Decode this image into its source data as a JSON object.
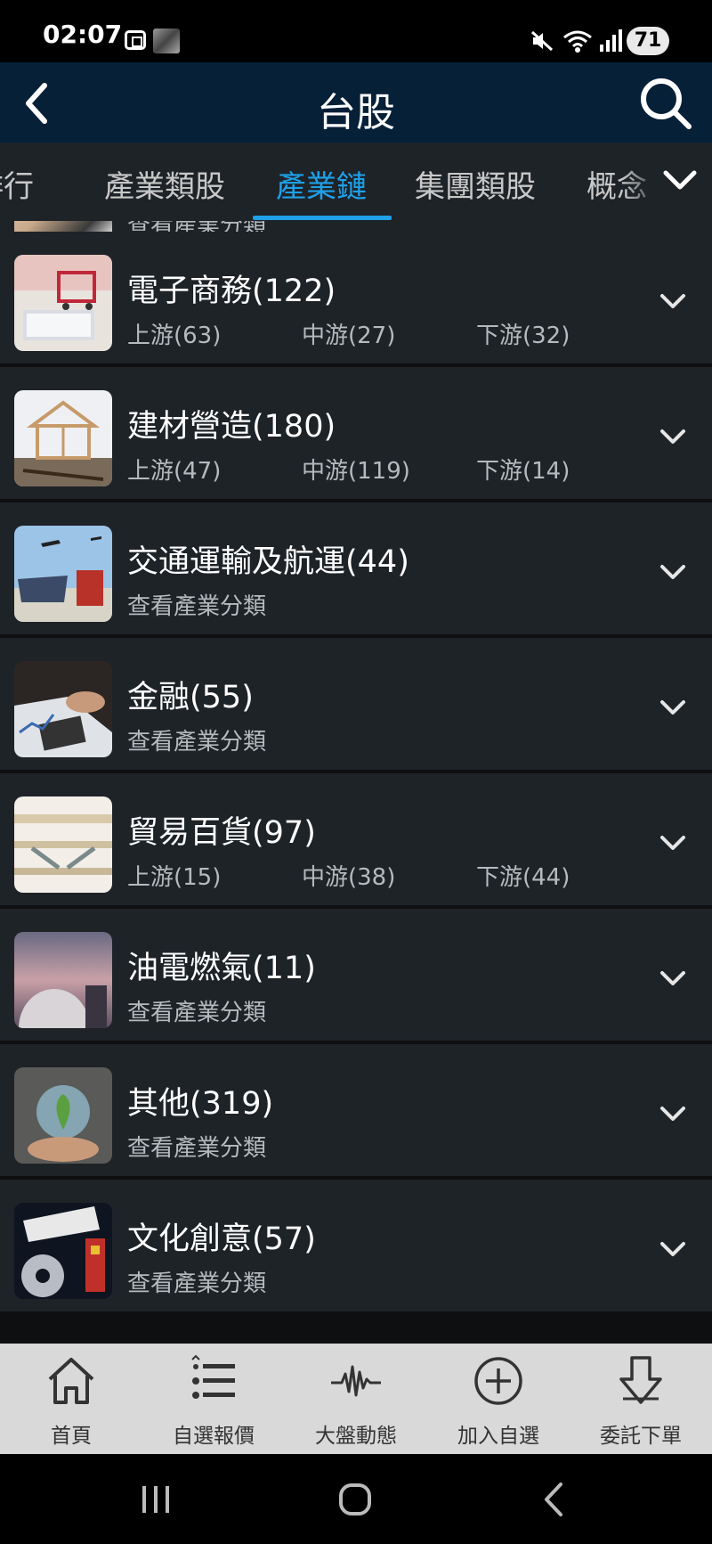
{
  "status_bar": {
    "time": "02:07",
    "battery": "71"
  },
  "header": {
    "title": "台股"
  },
  "tabs": [
    {
      "label": "排行"
    },
    {
      "label": "產業類股"
    },
    {
      "label": "產業鏈"
    },
    {
      "label": "集團類股"
    },
    {
      "label": "概念"
    }
  ],
  "partial_row": {
    "sub": "查看產業分類"
  },
  "rows": [
    {
      "title": "電子商務(122)",
      "upstream": "上游(63)",
      "midstream": "中游(27)",
      "downstream": "下游(32)"
    },
    {
      "title": "建材營造(180)",
      "upstream": "上游(47)",
      "midstream": "中游(119)",
      "downstream": "下游(14)"
    },
    {
      "title": "交通運輸及航運(44)",
      "sub": "查看產業分類"
    },
    {
      "title": "金融(55)",
      "sub": "查看產業分類"
    },
    {
      "title": "貿易百貨(97)",
      "upstream": "上游(15)",
      "midstream": "中游(38)",
      "downstream": "下游(44)"
    },
    {
      "title": "油電燃氣(11)",
      "sub": "查看產業分類"
    },
    {
      "title": "其他(319)",
      "sub": "查看產業分類"
    },
    {
      "title": "文化創意(57)",
      "sub": "查看產業分類"
    }
  ],
  "bottom_nav": [
    {
      "label": "首頁",
      "icon": "home-icon"
    },
    {
      "label": "自選報價",
      "icon": "list-icon"
    },
    {
      "label": "大盤動態",
      "icon": "pulse-icon"
    },
    {
      "label": "加入自選",
      "icon": "add-circle-icon"
    },
    {
      "label": "委託下單",
      "icon": "order-arrow-icon"
    }
  ],
  "colors": {
    "header_bg": "#062038",
    "active_tab": "#1fa0e8",
    "list_bg": "#1e2328",
    "bottom_nav_bg": "#d9d9d9"
  }
}
